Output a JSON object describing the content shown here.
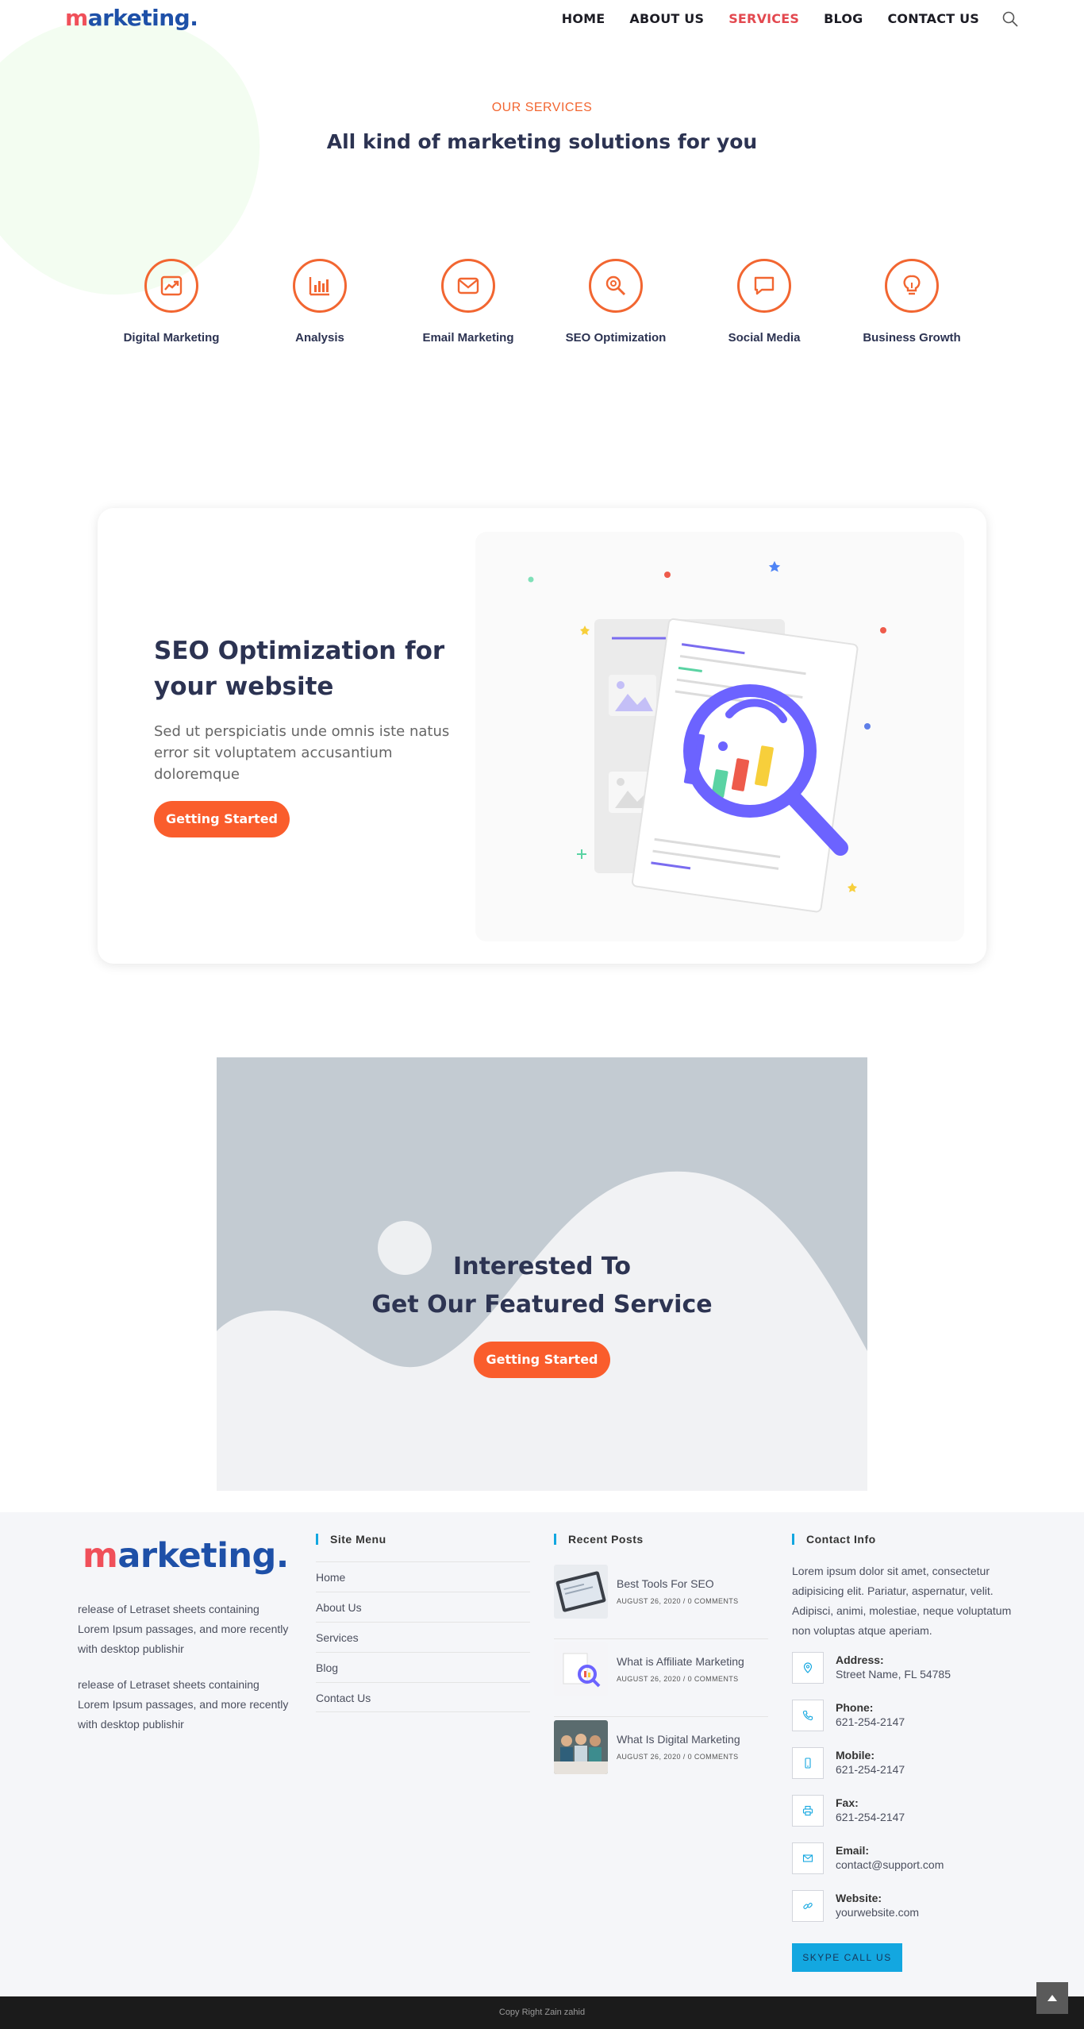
{
  "header": {
    "logo": {
      "m": "m",
      "rest": "arketing",
      "dot": "."
    },
    "nav": [
      "HOME",
      "ABOUT US",
      "SERVICES",
      "BLOG",
      "CONTACT US"
    ],
    "active_nav": "SERVICES",
    "search_icon": "search-icon"
  },
  "services": {
    "kicker": "OUR SERVICES",
    "headline": "All kind of marketing solutions for you",
    "items": [
      {
        "label": "Digital Marketing",
        "icon": "trending-up-icon"
      },
      {
        "label": "Analysis",
        "icon": "bar-chart-icon"
      },
      {
        "label": "Email Marketing",
        "icon": "envelope-icon"
      },
      {
        "label": "SEO Optimization",
        "icon": "search-gear-icon"
      },
      {
        "label": "Social Media",
        "icon": "chat-bubble-icon"
      },
      {
        "label": "Business Growth",
        "icon": "lightbulb-icon"
      }
    ]
  },
  "seo_card": {
    "title": "SEO Optimization for your website",
    "text": "Sed ut perspiciatis unde omnis iste natus error sit voluptatem accusantium doloremque",
    "button": "Getting Started"
  },
  "cta": {
    "line1": "Interested To",
    "line2": "Get Our Featured Service",
    "button": "Getting Started"
  },
  "footer": {
    "logo": {
      "m": "m",
      "rest": "arketing",
      "dot": "."
    },
    "about": [
      "release of Letraset sheets containing Lorem Ipsum passages, and more recently with desktop publishir",
      "release of Letraset sheets containing Lorem Ipsum passages, and more recently with desktop publishir"
    ],
    "site_menu": {
      "title": "Site Menu",
      "items": [
        "Home",
        "About Us",
        "Services",
        "Blog",
        "Contact Us"
      ]
    },
    "recent_posts": {
      "title": "Recent Posts",
      "items": [
        {
          "title": "Best Tools For SEO",
          "meta": "AUGUST 26, 2020 / 0 COMMENTS"
        },
        {
          "title": "What is Affiliate Marketing",
          "meta": "AUGUST 26, 2020 / 0 COMMENTS"
        },
        {
          "title": "What Is Digital Marketing",
          "meta": "AUGUST 26, 2020 / 0 COMMENTS"
        }
      ]
    },
    "contact": {
      "title": "Contact Info",
      "intro": "Lorem ipsum dolor sit amet, consectetur adipisicing elit. Pariatur, aspernatur, velit. Adipisci, animi, molestiae, neque voluptatum non voluptas atque aperiam.",
      "items": [
        {
          "label": "Address:",
          "value": "Street Name, FL 54785",
          "icon": "map-pin-icon"
        },
        {
          "label": "Phone:",
          "value": "621-254-2147",
          "icon": "phone-icon"
        },
        {
          "label": "Mobile:",
          "value": "621-254-2147",
          "icon": "mobile-icon"
        },
        {
          "label": "Fax:",
          "value": "621-254-2147",
          "icon": "printer-icon"
        },
        {
          "label": "Email:",
          "value": "contact@support.com",
          "icon": "mail-icon"
        },
        {
          "label": "Website:",
          "value": "yourwebsite.com",
          "icon": "link-icon"
        }
      ],
      "skype_button": "SKYPE CALL US"
    },
    "copyright": "Copy Right Zain zahid"
  },
  "colors": {
    "accent": "#f26631",
    "button": "#fa5d2c",
    "nav_active": "#e3484f",
    "brand_red": "#f0505a",
    "brand_blue": "#1e50a8",
    "footer_accent": "#13a7e0"
  }
}
